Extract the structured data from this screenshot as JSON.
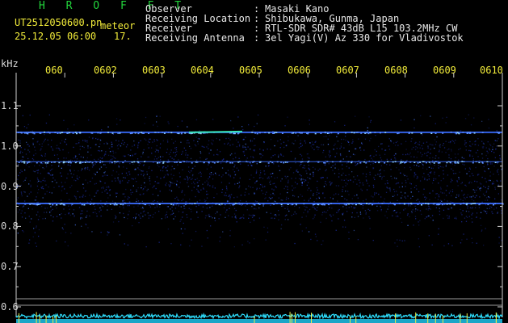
{
  "header": {
    "station": "H R O F F T",
    "filename": "UT2512050600.pn",
    "mode": "meteor",
    "datetime": "25.12.05 06:00",
    "count": "17.",
    "fields": [
      {
        "label": "Observer",
        "sep": ":",
        "value": "Masaki Kano"
      },
      {
        "label": "Receiving Location",
        "sep": ":",
        "value": "Shibukawa, Gunma, Japan"
      },
      {
        "label": "Receiver",
        "sep": ":",
        "value": "RTL-SDR SDR# 43dB L15 103.2MHz CW"
      },
      {
        "label": "Receiving Antenna",
        "sep": ":",
        "value": "3el Yagi(V) Az 330 for Vladivostok"
      }
    ]
  },
  "spectrogram": {
    "y_unit": "kHz",
    "y_ticks": [
      "1.1",
      "1.0",
      "0.9",
      "0.8",
      "0.7",
      "0.6"
    ],
    "x_ticks": [
      "060",
      "0602",
      "0603",
      "0604",
      "0605",
      "0606",
      "0607",
      "0608",
      "0609",
      "0610"
    ],
    "signal_lines_khz": [
      1.034,
      0.961,
      0.857
    ],
    "colors": {
      "background": "#000000",
      "signal": "#3a6cff",
      "noise": "#1a2a9a",
      "baseline": "#2ee0ff",
      "frame": "#cfcfcf"
    }
  }
}
